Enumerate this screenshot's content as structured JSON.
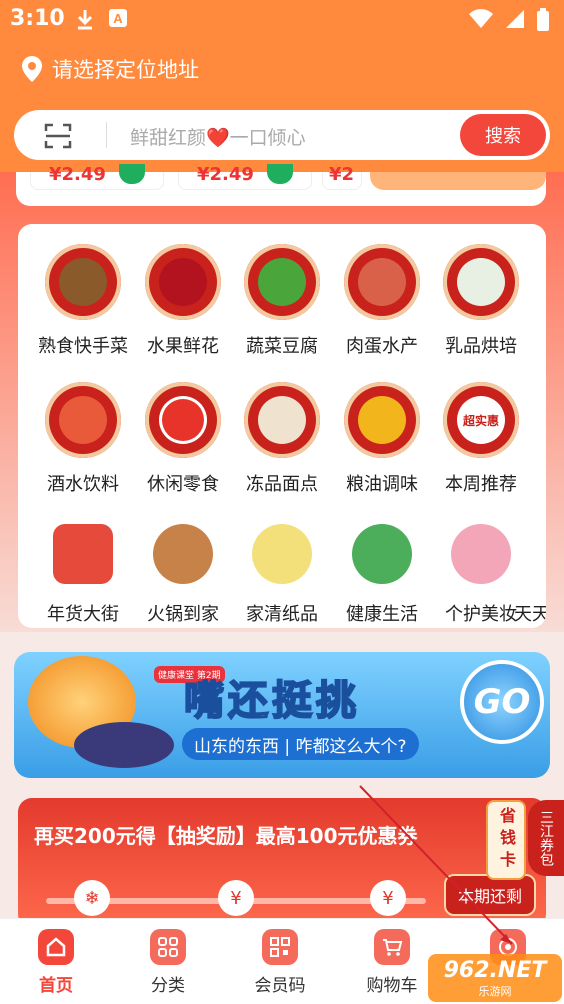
{
  "status_bar": {
    "time": "3:10"
  },
  "location": {
    "label": "请选择定位地址"
  },
  "search": {
    "placeholder": "鲜甜红颜❤️一口倾心",
    "button_label": "搜索"
  },
  "product_strip": {
    "prices": [
      "¥2.49",
      "¥2.49",
      "¥2"
    ]
  },
  "categories": [
    {
      "label": "熟食快手菜",
      "icon": "cooked-food-icon",
      "color": "#8a5a2a"
    },
    {
      "label": "水果鲜花",
      "icon": "cherry-icon",
      "color": "#b3121f"
    },
    {
      "label": "蔬菜豆腐",
      "icon": "vegetable-icon",
      "color": "#4aa63b"
    },
    {
      "label": "肉蛋水产",
      "icon": "meat-icon",
      "color": "#d9614a"
    },
    {
      "label": "乳品烘培",
      "icon": "milk-icon",
      "color": "#e8f0e4"
    },
    {
      "label": "酒水饮料",
      "icon": "drinks-icon",
      "color": "#e85a3a"
    },
    {
      "label": "休闲零食",
      "icon": "snack-icon",
      "color": "#e8332a"
    },
    {
      "label": "冻品面点",
      "icon": "dumpling-icon",
      "color": "#efe3cf"
    },
    {
      "label": "粮油调味",
      "icon": "oil-icon",
      "color": "#f2b51c"
    },
    {
      "label": "本周推荐",
      "icon": "weekly-deal-icon",
      "color": "#ffffff"
    },
    {
      "label": "年货大街",
      "icon": "new-year-icon",
      "color": "#e64a3a"
    },
    {
      "label": "火锅到家",
      "icon": "hotpot-icon",
      "color": "#c7824a"
    },
    {
      "label": "家清纸品",
      "icon": "tissue-icon",
      "color": "#f3e07a"
    },
    {
      "label": "健康生活",
      "icon": "organic-icon",
      "color": "#4cae5a"
    },
    {
      "label": "个护美妆",
      "icon": "cosmetics-icon",
      "color": "#f3a6b8"
    },
    {
      "label": "天天",
      "icon": "partial-icon",
      "color": "#f2c27a"
    }
  ],
  "weekly_deal_text": "超实惠",
  "promo_banner": {
    "headline": "嘴还挺挑",
    "subline": "山东的东西 | 咋都这么大个?",
    "go_label": "GO",
    "badge": "健康课堂 第2期"
  },
  "reward_banner": {
    "title": "再买200元得【抽奖励】最高100元优惠券",
    "remaining_label": "本期还剩",
    "saving_card": "省钱卡",
    "coupon_tag": "三江券包"
  },
  "bottom_nav": [
    {
      "label": "首页",
      "icon": "home-icon",
      "active": true
    },
    {
      "label": "分类",
      "icon": "category-icon",
      "active": false
    },
    {
      "label": "会员码",
      "icon": "member-code-icon",
      "active": false
    },
    {
      "label": "购物车",
      "icon": "cart-icon",
      "active": false
    }
  ],
  "watermark": {
    "big": "962.NET",
    "small": "乐游网"
  },
  "colors": {
    "header": "#ff8a3d",
    "accent": "#f4473b",
    "category_ring": "#c9211c"
  }
}
